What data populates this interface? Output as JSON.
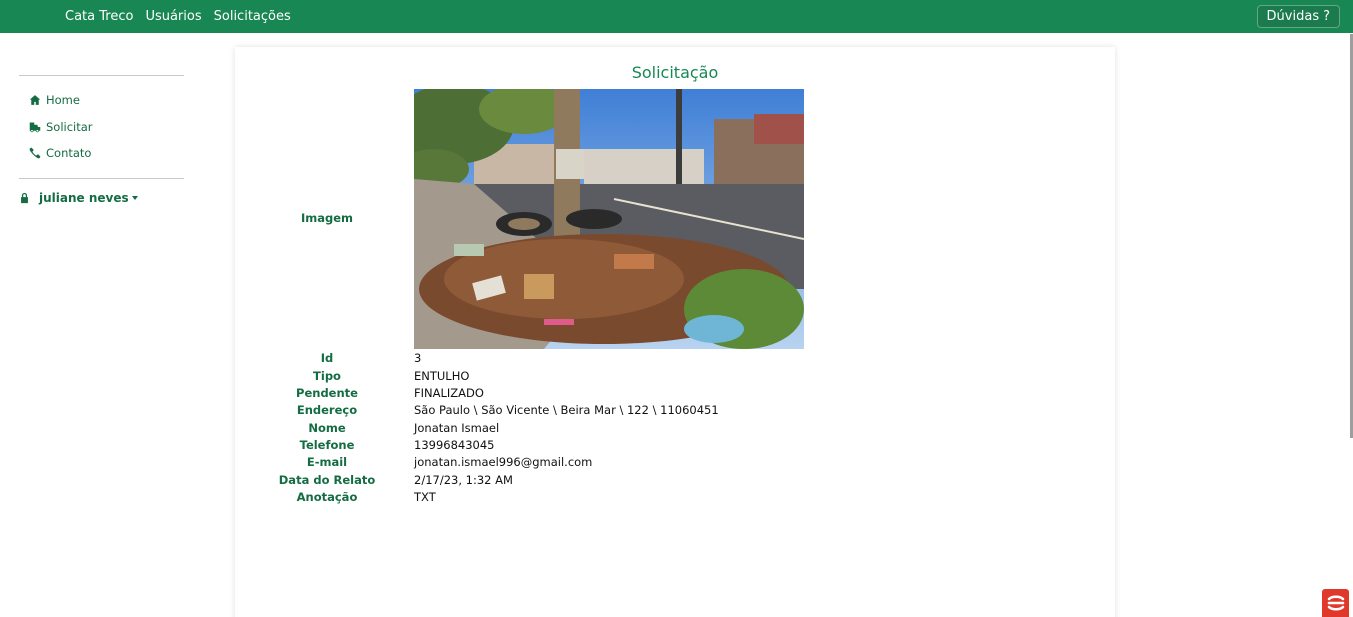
{
  "navbar": {
    "brand": "Cata Treco",
    "links": [
      "Usuários",
      "Solicitações"
    ],
    "help_label": "Dúvidas",
    "help_icon": "?",
    "color": "#198754"
  },
  "sidebar": {
    "items": [
      {
        "label": "Home",
        "icon": "home-icon"
      },
      {
        "label": "Solicitar",
        "icon": "dump-truck-icon"
      },
      {
        "label": "Contato",
        "icon": "phone-icon"
      }
    ],
    "user": {
      "name": "juliane neves",
      "icon": "lock-icon"
    }
  },
  "main": {
    "title": "Solicitação",
    "fields": {
      "imagem": {
        "label": "Imagem"
      },
      "id": {
        "label": "Id",
        "value": "3"
      },
      "tipo": {
        "label": "Tipo",
        "value": "ENTULHO"
      },
      "pendente": {
        "label": "Pendente",
        "value": "FINALIZADO"
      },
      "endereco": {
        "label": "Endereço",
        "value": "São Paulo \\ São Vicente \\ Beira Mar \\ 122 \\ 11060451"
      },
      "nome": {
        "label": "Nome",
        "value": "Jonatan Ismael"
      },
      "telefone": {
        "label": "Telefone",
        "value": "13996843045"
      },
      "email": {
        "label": "E-mail",
        "value": "jonatan.ismael996@gmail.com"
      },
      "data": {
        "label": "Data do Relato",
        "value": "2/17/23, 1:32 AM"
      },
      "anotacao": {
        "label": "Anotação",
        "value": "TXT"
      }
    }
  },
  "colors": {
    "accent": "#198754",
    "label": "#146c43",
    "badge": "#e0382b"
  }
}
